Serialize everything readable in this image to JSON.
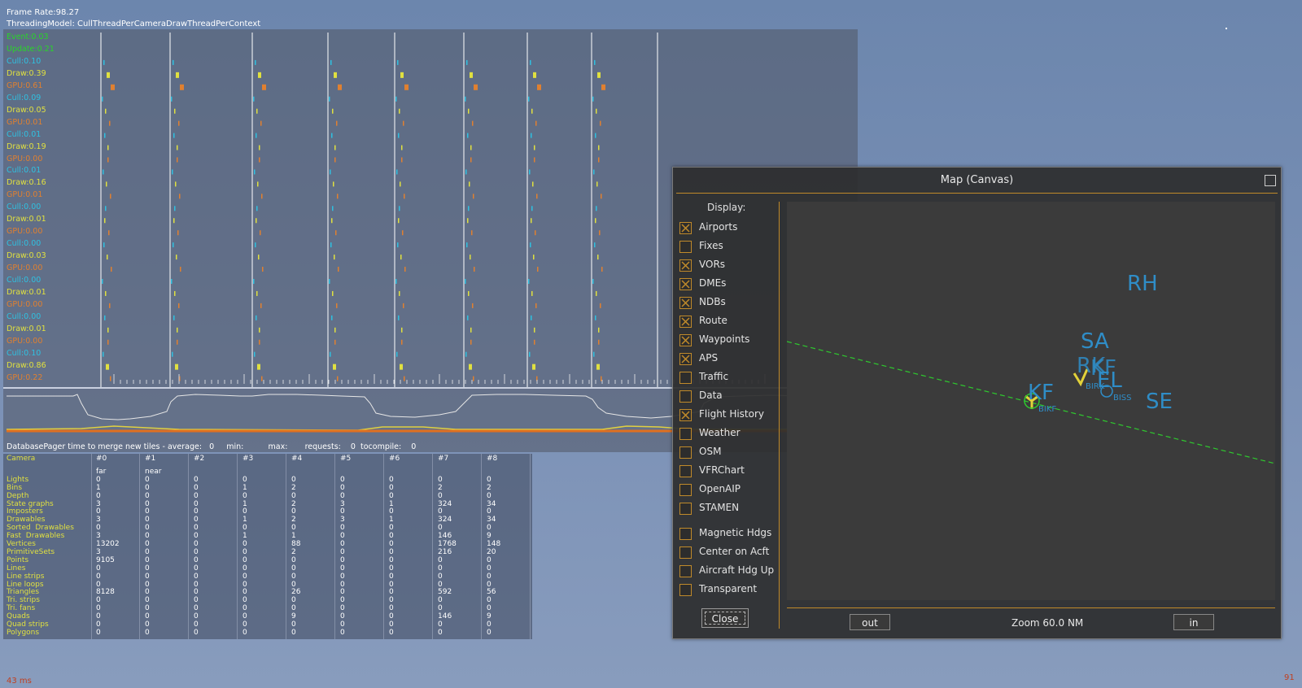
{
  "header": {
    "frame_rate": "Frame  Rate:98.27",
    "threading_model": "ThreadingModel:  CullThreadPerCameraDrawThreadPerContext"
  },
  "stats_rows": [
    {
      "label": "Event:0.03",
      "kind": "event"
    },
    {
      "label": "Update:0.21",
      "kind": "update"
    },
    {
      "label": "Cull:0.10",
      "kind": "cull"
    },
    {
      "label": "Draw:0.39",
      "kind": "draw"
    },
    {
      "label": "GPU:0.61",
      "kind": "gpu"
    },
    {
      "label": "Cull:0.09",
      "kind": "cull"
    },
    {
      "label": "Draw:0.05",
      "kind": "draw"
    },
    {
      "label": "GPU:0.01",
      "kind": "gpu"
    },
    {
      "label": "Cull:0.01",
      "kind": "cull"
    },
    {
      "label": "Draw:0.19",
      "kind": "draw"
    },
    {
      "label": "GPU:0.00",
      "kind": "gpu"
    },
    {
      "label": "Cull:0.01",
      "kind": "cull"
    },
    {
      "label": "Draw:0.16",
      "kind": "draw"
    },
    {
      "label": "GPU:0.01",
      "kind": "gpu"
    },
    {
      "label": "Cull:0.00",
      "kind": "cull"
    },
    {
      "label": "Draw:0.01",
      "kind": "draw"
    },
    {
      "label": "GPU:0.00",
      "kind": "gpu"
    },
    {
      "label": "Cull:0.00",
      "kind": "cull"
    },
    {
      "label": "Draw:0.03",
      "kind": "draw"
    },
    {
      "label": "GPU:0.00",
      "kind": "gpu"
    },
    {
      "label": "Cull:0.00",
      "kind": "cull"
    },
    {
      "label": "Draw:0.01",
      "kind": "draw"
    },
    {
      "label": "GPU:0.00",
      "kind": "gpu"
    },
    {
      "label": "Cull:0.00",
      "kind": "cull"
    },
    {
      "label": "Draw:0.01",
      "kind": "draw"
    },
    {
      "label": "GPU:0.00",
      "kind": "gpu"
    },
    {
      "label": "Cull:0.10",
      "kind": "cull"
    },
    {
      "label": "Draw:0.86",
      "kind": "draw"
    },
    {
      "label": "GPU:0.22",
      "kind": "gpu"
    }
  ],
  "pager": {
    "text": "DatabasePager time to merge new tiles - average:   0     min:          max:       requests:    0  tocompile:    0"
  },
  "camera_table": {
    "row_labels": [
      "Camera",
      "",
      "Lights",
      "Bins",
      "Depth",
      "State graphs",
      "Imposters",
      "Drawables",
      "Sorted  Drawables",
      "Fast  Drawables",
      "Vertices",
      "PrimitiveSets",
      "Points",
      "Lines",
      "Line strips",
      "Line loops",
      "Triangles",
      "Tri. strips",
      "Tri. fans",
      "Quads",
      "Quad strips",
      "Polygons"
    ],
    "columns": [
      {
        "head": "#0",
        "sub": "far",
        "values": [
          "0",
          "1",
          "0",
          "3",
          "0",
          "3",
          "0",
          "3",
          "13202",
          "3",
          "9105",
          "0",
          "0",
          "0",
          "8128",
          "0",
          "0",
          "0",
          "0",
          "0"
        ]
      },
      {
        "head": "#1",
        "sub": "near",
        "values": [
          "0",
          "0",
          "0",
          "0",
          "0",
          "0",
          "0",
          "0",
          "0",
          "0",
          "0",
          "0",
          "0",
          "0",
          "0",
          "0",
          "0",
          "0",
          "0",
          "0"
        ]
      },
      {
        "head": "#2",
        "sub": "",
        "values": [
          "0",
          "0",
          "0",
          "0",
          "0",
          "0",
          "0",
          "0",
          "0",
          "0",
          "0",
          "0",
          "0",
          "0",
          "0",
          "0",
          "0",
          "0",
          "0",
          "0"
        ]
      },
      {
        "head": "#3",
        "sub": "",
        "values": [
          "0",
          "1",
          "0",
          "1",
          "0",
          "1",
          "0",
          "1",
          "0",
          "0",
          "0",
          "0",
          "0",
          "0",
          "0",
          "0",
          "0",
          "0",
          "0",
          "0"
        ]
      },
      {
        "head": "#4",
        "sub": "",
        "values": [
          "0",
          "2",
          "0",
          "2",
          "0",
          "2",
          "0",
          "1",
          "88",
          "2",
          "0",
          "0",
          "0",
          "0",
          "26",
          "0",
          "0",
          "9",
          "0",
          "0"
        ]
      },
      {
        "head": "#5",
        "sub": "",
        "values": [
          "0",
          "0",
          "0",
          "3",
          "0",
          "3",
          "0",
          "0",
          "0",
          "0",
          "0",
          "0",
          "0",
          "0",
          "0",
          "0",
          "0",
          "0",
          "0",
          "0"
        ]
      },
      {
        "head": "#6",
        "sub": "",
        "values": [
          "0",
          "0",
          "0",
          "1",
          "0",
          "1",
          "0",
          "0",
          "0",
          "0",
          "0",
          "0",
          "0",
          "0",
          "0",
          "0",
          "0",
          "0",
          "0",
          "0"
        ]
      },
      {
        "head": "#7",
        "sub": "",
        "values": [
          "0",
          "2",
          "0",
          "324",
          "0",
          "324",
          "0",
          "146",
          "1768",
          "216",
          "0",
          "0",
          "0",
          "0",
          "592",
          "0",
          "0",
          "146",
          "0",
          "0"
        ]
      },
      {
        "head": "#8",
        "sub": "",
        "values": [
          "0",
          "2",
          "0",
          "34",
          "0",
          "34",
          "0",
          "9",
          "148",
          "20",
          "0",
          "0",
          "0",
          "0",
          "56",
          "0",
          "0",
          "9",
          "0",
          "0"
        ]
      }
    ]
  },
  "map_window": {
    "title": "Map (Canvas)",
    "display_label": "Display:",
    "options": [
      {
        "label": "Airports",
        "checked": true
      },
      {
        "label": "Fixes",
        "checked": false
      },
      {
        "label": "VORs",
        "checked": true
      },
      {
        "label": "DMEs",
        "checked": true
      },
      {
        "label": "NDBs",
        "checked": true
      },
      {
        "label": "Route",
        "checked": true
      },
      {
        "label": "Waypoints",
        "checked": true
      },
      {
        "label": "APS",
        "checked": true
      },
      {
        "label": "Traffic",
        "checked": false
      },
      {
        "label": "Data",
        "checked": false
      },
      {
        "label": "Flight History",
        "checked": true
      },
      {
        "label": "Weather",
        "checked": false
      },
      {
        "label": "OSM",
        "checked": false
      },
      {
        "label": "VFRChart",
        "checked": false
      },
      {
        "label": "OpenAIP",
        "checked": false
      },
      {
        "label": "STAMEN",
        "checked": false
      },
      {
        "label": "Magnetic Hdgs",
        "checked": false
      },
      {
        "label": "Center on Acft",
        "checked": false
      },
      {
        "label": "Aircraft Hdg Up",
        "checked": false
      },
      {
        "label": "Transparent",
        "checked": false
      }
    ],
    "close_label": "Close",
    "zoom_out_label": "out",
    "zoom_in_label": "in",
    "zoom_text": "Zoom 60.0 NM",
    "map_labels": {
      "rh": "RH",
      "sa": "SA",
      "rk": "RK",
      "kef": "KF",
      "el": "EL",
      "se": "SE",
      "kf": "KF",
      "bikf": "BIKF",
      "birk": "BIRK",
      "biss": "BISS"
    },
    "colors": {
      "accent": "#c08a2a",
      "vor_label": "#2f8dc7",
      "route": "#2ec92e",
      "airport": "#e2d23a"
    }
  },
  "corners": {
    "left_text": "43 ms",
    "right_text": "91"
  }
}
